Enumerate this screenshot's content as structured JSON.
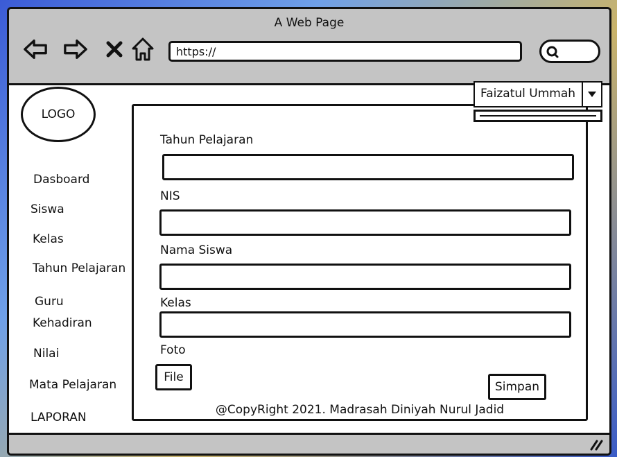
{
  "browser": {
    "title": "A Web Page",
    "url": "https://",
    "icons": {
      "back": "arrow-left-icon",
      "forward": "arrow-right-icon",
      "stop": "close-icon",
      "home": "home-icon",
      "search": "search-icon",
      "resize": "resize-grip-icon"
    }
  },
  "logo": {
    "label": "LOGO"
  },
  "sidebar": {
    "items": [
      {
        "label": "Dasboard"
      },
      {
        "label": "Siswa"
      },
      {
        "label": "Kelas"
      },
      {
        "label": "Tahun Pelajaran"
      },
      {
        "label": "Guru"
      },
      {
        "label": "Kehadiran"
      },
      {
        "label": "Nilai"
      },
      {
        "label": "Mata Pelajaran"
      },
      {
        "label": "LAPORAN"
      }
    ]
  },
  "user_menu": {
    "name": "Faizatul Ummah"
  },
  "form": {
    "fields": [
      {
        "label": "Tahun Pelajaran",
        "value": ""
      },
      {
        "label": "NIS",
        "value": ""
      },
      {
        "label": "Nama Siswa",
        "value": ""
      },
      {
        "label": "Kelas",
        "value": ""
      }
    ],
    "photo_label": "Foto",
    "file_button": "File",
    "save_button": "Simpan"
  },
  "footer": {
    "text": "@CopyRight 2021. Madrasah Diniyah Nurul Jadid"
  },
  "colors": {
    "chrome": "#c4c4c4",
    "stroke": "#111111",
    "background": "#ffffff"
  }
}
